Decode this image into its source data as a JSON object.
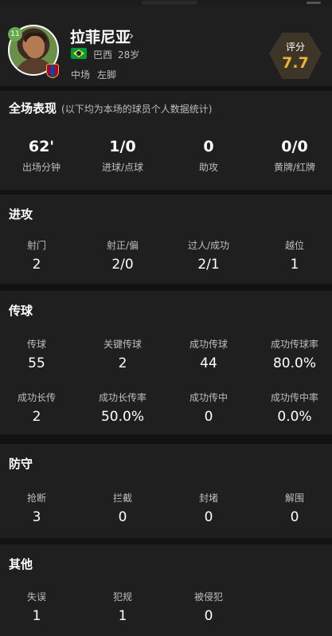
{
  "header": {
    "number": "11",
    "name": "拉菲尼亚",
    "chevron": "›",
    "nation": "巴西",
    "age": "28岁",
    "position": "中场",
    "foot": "左脚",
    "rating_label": "评分",
    "rating_value": "7.7",
    "flag_icon": "brazil-flag-icon",
    "club_icon": "barcelona-crest-icon",
    "rating_color": "#f0b232"
  },
  "summary": {
    "title": "全场表现",
    "note": "(以下均为本场的球员个人数据统计)",
    "stats": [
      {
        "value": "62'",
        "label": "出场分钟"
      },
      {
        "value": "1/0",
        "label": "进球/点球"
      },
      {
        "value": "0",
        "label": "助攻"
      },
      {
        "value": "0/0",
        "label": "黄牌/红牌"
      }
    ]
  },
  "attack": {
    "title": "进攻",
    "stats": [
      {
        "label": "射门",
        "value": "2"
      },
      {
        "label": "射正/偏",
        "value": "2/0"
      },
      {
        "label": "过人/成功",
        "value": "2/1"
      },
      {
        "label": "越位",
        "value": "1"
      }
    ]
  },
  "passing": {
    "title": "传球",
    "stats": [
      {
        "label": "传球",
        "value": "55"
      },
      {
        "label": "关键传球",
        "value": "2"
      },
      {
        "label": "成功传球",
        "value": "44"
      },
      {
        "label": "成功传球率",
        "value": "80.0%"
      },
      {
        "label": "成功长传",
        "value": "2"
      },
      {
        "label": "成功长传率",
        "value": "50.0%"
      },
      {
        "label": "成功传中",
        "value": "0"
      },
      {
        "label": "成功传中率",
        "value": "0.0%"
      }
    ]
  },
  "defense": {
    "title": "防守",
    "stats": [
      {
        "label": "抢断",
        "value": "3"
      },
      {
        "label": "拦截",
        "value": "0"
      },
      {
        "label": "封堵",
        "value": "0"
      },
      {
        "label": "解围",
        "value": "0"
      }
    ]
  },
  "other": {
    "title": "其他",
    "stats": [
      {
        "label": "失误",
        "value": "1"
      },
      {
        "label": "犯规",
        "value": "1"
      },
      {
        "label": "被侵犯",
        "value": "0"
      }
    ]
  }
}
